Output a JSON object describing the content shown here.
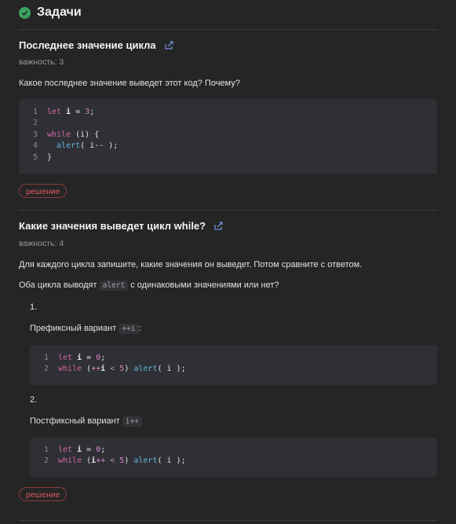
{
  "header": {
    "title": "Задачи"
  },
  "task1": {
    "title": "Последнее значение цикла",
    "importance": "важность: 3",
    "question": "Какое последнее значение выведет этот код? Почему?",
    "solution_label": "решение",
    "code": {
      "line_numbers": [
        "1",
        "2",
        "3",
        "4",
        "5"
      ],
      "l1": {
        "let": "let",
        "var": "i",
        "eq": " = ",
        "num": "3",
        "semi": ";"
      },
      "l3": {
        "while": "while",
        "cond": " (i) {"
      },
      "l4": {
        "fn": "alert",
        "rest": "( i-- );"
      },
      "l5": {
        "rest": "}"
      }
    }
  },
  "task2": {
    "title": "Какие значения выведет цикл while?",
    "importance": "важность: 4",
    "p1": "Для каждого цикла запишите, какие значения он выведет. Потом сравните с ответом.",
    "p2_before": "Оба цикла выводят",
    "p2_code": "alert",
    "p2_after": "с одинаковыми значениями или нет?",
    "item1": {
      "num": "1.",
      "text": "Префиксный вариант",
      "code": "++i",
      "after": ":",
      "line_numbers": [
        "1",
        "2"
      ],
      "l1": {
        "let": "let",
        "var": "i",
        "eq": " = ",
        "num": "0",
        "semi": ";"
      },
      "l2": {
        "while": "while",
        "open": " (",
        "op": "++",
        "var": "i",
        "lt": " < ",
        "num": "5",
        "close": ") ",
        "fn": "alert",
        "rest": "( i );"
      }
    },
    "item2": {
      "num": "2.",
      "text": "Постфиксный вариант",
      "code": "i++",
      "line_numbers": [
        "1",
        "2"
      ],
      "l1": {
        "let": "let",
        "var": "i",
        "eq": " = ",
        "num": "0",
        "semi": ";"
      },
      "l2": {
        "while": "while",
        "open": " (",
        "var": "i",
        "op": "++",
        "lt": " < ",
        "num": "5",
        "close": ") ",
        "fn": "alert",
        "rest": "( i );"
      }
    },
    "solution_label": "решение"
  }
}
